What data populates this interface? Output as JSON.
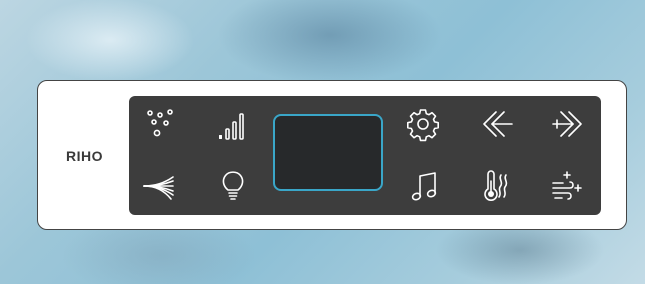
{
  "brand": {
    "logo_text": "RIHO"
  },
  "controls": {
    "top_row": [
      "air-bubbles",
      "intensity-level",
      "settings",
      "previous",
      "next"
    ],
    "bottom_row": [
      "water-jets",
      "light",
      "music",
      "temperature",
      "disinfection"
    ]
  },
  "colors": {
    "panel": "#ffffff",
    "control_surface": "#3d3d3d",
    "screen": "#27292b",
    "screen_border": "#3aa6c8",
    "icon": "#ffffff"
  }
}
